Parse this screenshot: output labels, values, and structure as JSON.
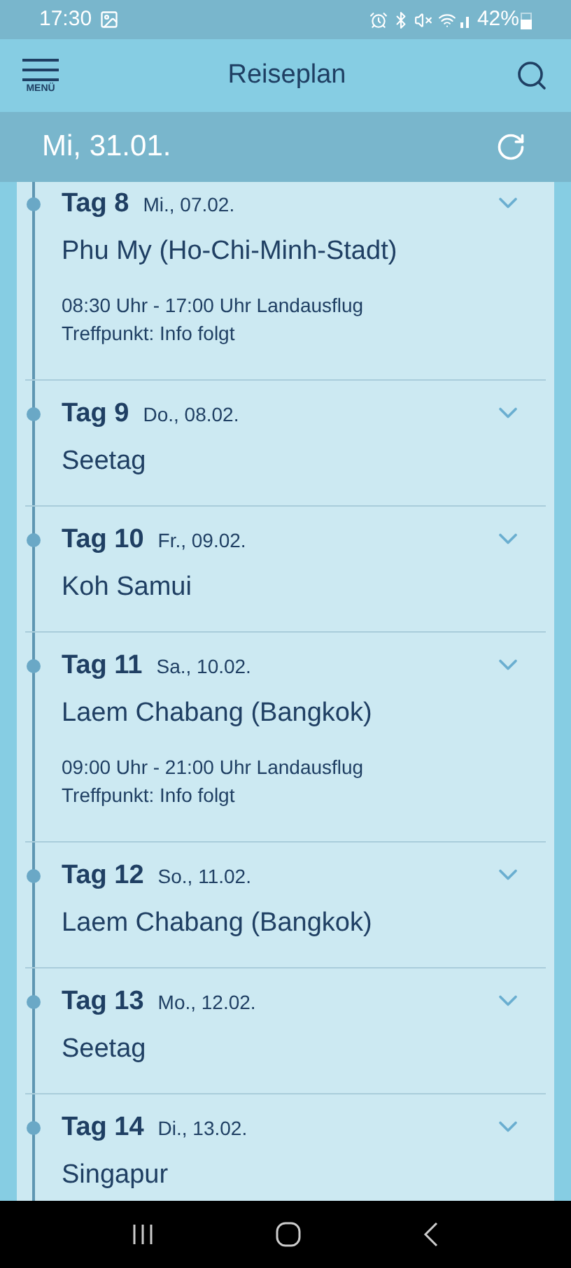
{
  "status_bar": {
    "time": "17:30",
    "battery": "42%"
  },
  "header": {
    "menu_label": "MENÜ",
    "title": "Reiseplan"
  },
  "date_bar": {
    "date": "Mi, 31.01."
  },
  "days": [
    {
      "day": "Tag 8",
      "date": "Mi., 07.02.",
      "place": "Phu My (Ho-Chi-Minh-Stadt)",
      "details": [
        "08:30 Uhr - 17:00 Uhr Landausflug",
        "Treffpunkt: Info folgt"
      ],
      "expanded": false
    },
    {
      "day": "Tag 9",
      "date": "Do., 08.02.",
      "place": "Seetag",
      "expanded": false
    },
    {
      "day": "Tag 10",
      "date": "Fr., 09.02.",
      "place": "Koh Samui",
      "expanded": false
    },
    {
      "day": "Tag 11",
      "date": "Sa., 10.02.",
      "place": "Laem Chabang (Bangkok)",
      "details": [
        "09:00 Uhr - 21:00 Uhr Landausflug",
        "Treffpunkt: Info folgt"
      ],
      "expanded": false
    },
    {
      "day": "Tag 12",
      "date": "So., 11.02.",
      "place": "Laem Chabang (Bangkok)",
      "expanded": false
    },
    {
      "day": "Tag 13",
      "date": "Mo., 12.02.",
      "place": "Seetag",
      "expanded": false
    },
    {
      "day": "Tag 14",
      "date": "Di., 13.02.",
      "place": "Singapur",
      "expanded": false
    }
  ]
}
